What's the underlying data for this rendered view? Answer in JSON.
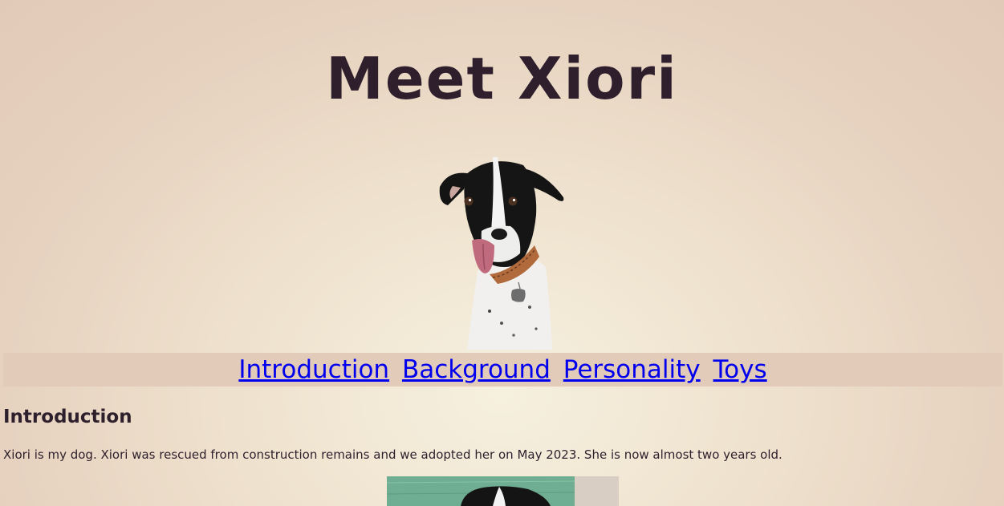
{
  "header": {
    "title": "Meet Xiori"
  },
  "nav": {
    "links": [
      {
        "label": "Introduction"
      },
      {
        "label": "Background"
      },
      {
        "label": "Personality"
      },
      {
        "label": "Toys"
      }
    ]
  },
  "introduction": {
    "heading": "Introduction",
    "text": "Xiori is my dog. Xiori was rescued from construction remains and we adopted her on May 2023. She is now almost two years old."
  },
  "colors": {
    "background": "#efe3cf",
    "nav_background": "#e2cbb8",
    "text": "#2e1f2c",
    "link": "#0000ee"
  }
}
